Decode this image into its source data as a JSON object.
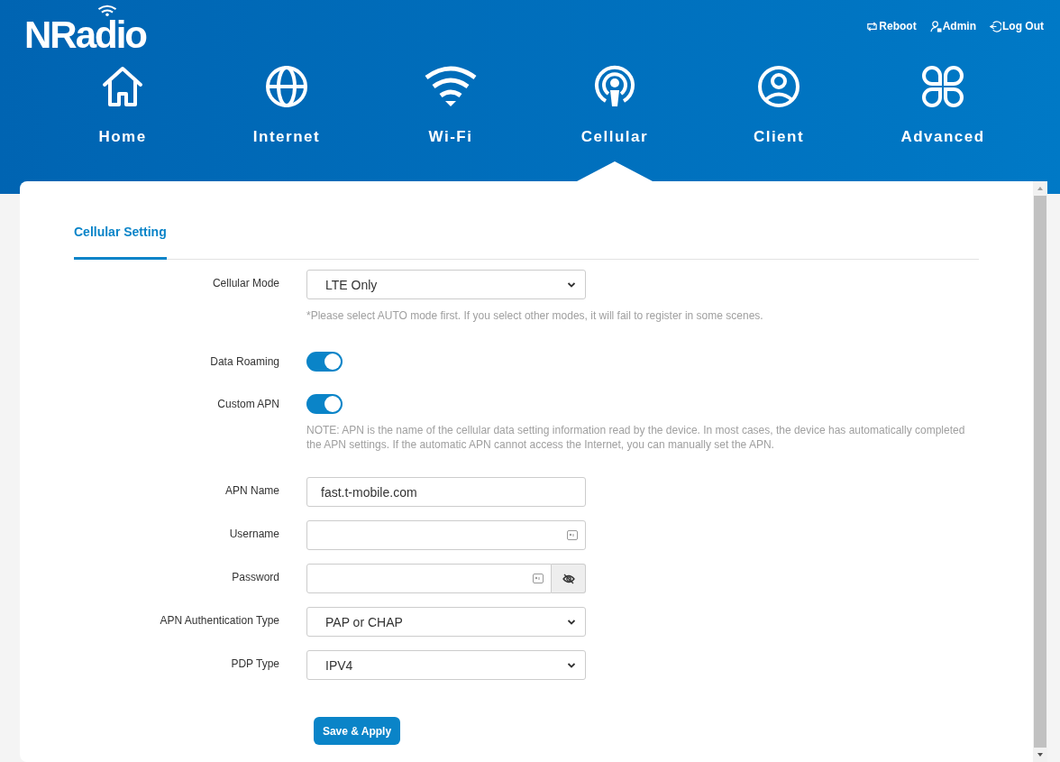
{
  "header": {
    "logo": "NRadio",
    "top_links": [
      {
        "kind": "reboot",
        "label": "Reboot"
      },
      {
        "kind": "admin",
        "label": "Admin"
      },
      {
        "kind": "logout",
        "label": "Log Out"
      }
    ]
  },
  "nav": [
    {
      "kind": "home",
      "label": "Home",
      "selected": false
    },
    {
      "kind": "internet",
      "label": "Internet",
      "selected": false
    },
    {
      "kind": "wifi",
      "label": "Wi-Fi",
      "selected": false
    },
    {
      "kind": "cellular",
      "label": "Cellular",
      "selected": true
    },
    {
      "kind": "client",
      "label": "Client",
      "selected": false
    },
    {
      "kind": "advanced",
      "label": "Advanced",
      "selected": false
    }
  ],
  "tabs": [
    {
      "label": "Cellular Setting",
      "selected": true
    }
  ],
  "form": [
    {
      "kind": "select",
      "label": "Cellular Mode",
      "value": "LTE Only",
      "hint": "*Please select AUTO mode first. If you select other modes, it will fail to register in some scenes."
    },
    {
      "kind": "toggle",
      "label": "Data Roaming",
      "on": true
    },
    {
      "kind": "toggle",
      "label": "Custom APN",
      "on": true,
      "hint": "NOTE: APN is the name of the cellular data setting information read by the device. In most cases, the device has automatically completed the APN settings. If the automatic APN cannot access the Internet, you can manually set the APN."
    },
    {
      "kind": "text",
      "label": "APN Name",
      "value": "fast.t-mobile.com"
    },
    {
      "kind": "text",
      "label": "Username"
    },
    {
      "kind": "password",
      "label": "Password"
    },
    {
      "kind": "select",
      "label": "APN Authentication Type",
      "value": "PAP or CHAP"
    },
    {
      "kind": "select",
      "label": "PDP Type",
      "value": "IPV4"
    }
  ],
  "save_button": "Save & Apply"
}
